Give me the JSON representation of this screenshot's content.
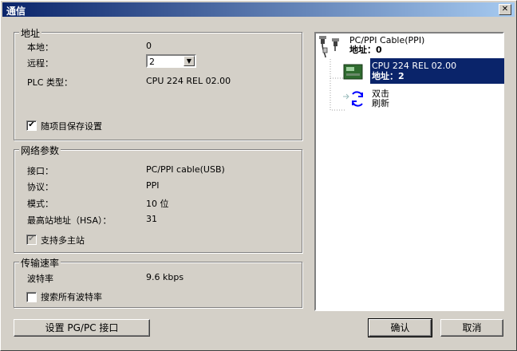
{
  "window": {
    "title": "通信",
    "close_glyph": "✕"
  },
  "address": {
    "legend": "地址",
    "local_label": "本地：",
    "local_value": "0",
    "remote_label": "远程：",
    "remote_value": "2",
    "plc_type_label": "PLC 类型：",
    "plc_type_value": "CPU 224 REL 02.00",
    "save_setting_label": "随项目保存设置",
    "save_setting_checked": "✔"
  },
  "network": {
    "legend": "网络参数",
    "interface_label": "接口：",
    "interface_value": "PC/PPI cable(USB)",
    "protocol_label": "协议：",
    "protocol_value": "PPI",
    "mode_label": "模式：",
    "mode_value": "10 位",
    "hsa_label": "最高站地址（HSA）：",
    "hsa_value": "31",
    "multimaster_label": "支持多主站",
    "multimaster_checked": "✔"
  },
  "baud": {
    "legend": "传输速率",
    "rate_label": "波特率",
    "rate_value": "9.6 kbps",
    "search_all_label": "搜索所有波特率"
  },
  "tree": {
    "cable_name": "PC/PPI Cable(PPI)",
    "cable_addr": "地址：0",
    "cpu_name": "CPU 224 REL 02.00",
    "cpu_addr": "地址：2",
    "refresh_line1": "双击",
    "refresh_line2": "刷新"
  },
  "buttons": {
    "set_pgpc": "设置 PG/PC 接口",
    "ok": "确认",
    "cancel": "取消"
  },
  "colors": {
    "selection": "#0a246a",
    "title_gradient_start": "#0a246a",
    "refresh_icon": "#0000ff"
  }
}
